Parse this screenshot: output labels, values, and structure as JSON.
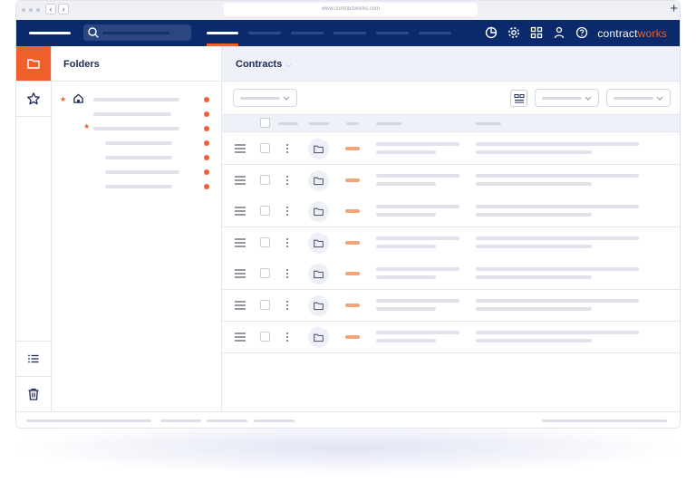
{
  "browser": {
    "url": "www.contractworks.com",
    "back_glyph": "‹",
    "forward_glyph": "›",
    "new_tab_glyph": "+"
  },
  "header": {
    "brand_prefix": "contract",
    "brand_suffix": "works",
    "icons": [
      "pie-chart-icon",
      "gear-icon",
      "grid-icon",
      "user-icon",
      "help-icon"
    ],
    "colors": {
      "background": "#0a2a6b",
      "accent": "#f0602a"
    }
  },
  "rail": {
    "items": [
      "folder-icon",
      "star-icon",
      "list-icon",
      "trash-icon"
    ],
    "active": "folder-icon"
  },
  "folders": {
    "title": "Folders"
  },
  "main": {
    "title": "Contracts",
    "title_caret": "⌵"
  }
}
